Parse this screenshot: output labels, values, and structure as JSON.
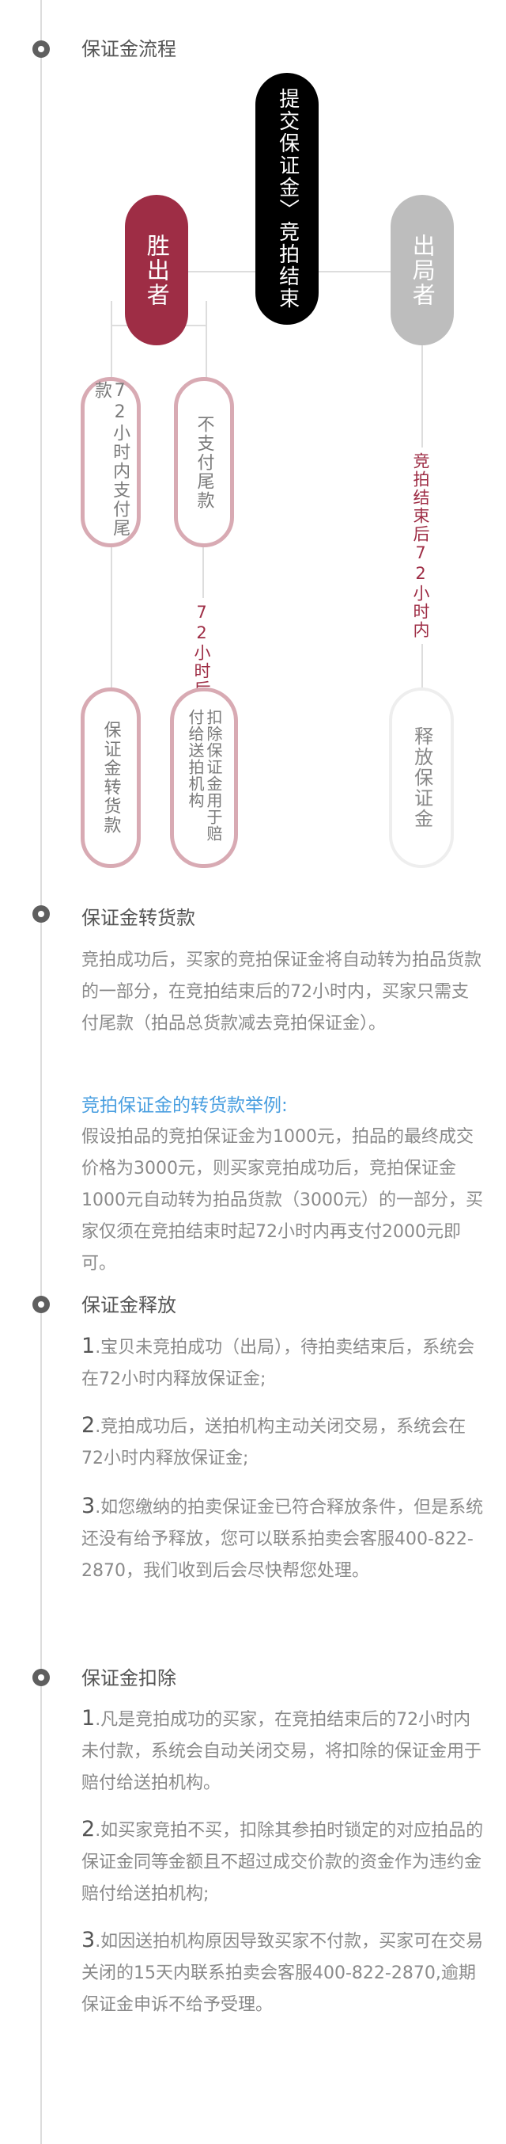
{
  "sections": {
    "flow": {
      "title": "保证金流程",
      "center_pill": "提交保证金〉竞拍结束",
      "winner_pill": "胜出者",
      "loser_pill": "出局者",
      "pay_within": "72小时内支付尾款",
      "not_pay": "不支付尾款",
      "after_72h": "72小时后",
      "to_payment": "保证金转货款",
      "deduct": "扣除保证金用于赔付给送拍机构",
      "loser_note": "竞拍结束后72小时内",
      "release": "释放保证金"
    },
    "convert": {
      "title": "保证金转货款",
      "desc": "竞拍成功后，买家的竞拍保证金将自动转为拍品货款的一部分，在竞拍结束后的72小时内，买家只需支付尾款（拍品总货款减去竞拍保证金）。",
      "example_title": "竞拍保证金的转货款举例:",
      "example": "假设拍品的竞拍保证金为1000元，拍品的最终成交价格为3000元，则买家竞拍成功后，竞拍保证金1000元自动转为拍品货款（3000元）的一部分，买家仅须在竞拍结束时起72小时内再支付2000元即可。"
    },
    "release": {
      "title": "保证金释放",
      "items": [
        {
          "num": "1",
          "text": ".宝贝未竞拍成功（出局），待拍卖结束后，系统会在72小时内释放保证金;"
        },
        {
          "num": "2",
          "text": ".竞拍成功后，送拍机构主动关闭交易，系统会在72小时内释放保证金;"
        },
        {
          "num": "3",
          "text": ".如您缴纳的拍卖保证金已符合释放条件，但是系统还没有给予释放，您可以联系拍卖会客服400-822-2870，我们收到后会尽快帮您处理。"
        }
      ]
    },
    "deduct": {
      "title": "保证金扣除",
      "items": [
        {
          "num": "1",
          "text": ".凡是竞拍成功的买家，在竞拍结束后的72小时内未付款，系统会自动关闭交易，将扣除的保证金用于赔付给送拍机构。"
        },
        {
          "num": "2",
          "text": ".如买家竞拍不买，扣除其参拍时锁定的对应拍品的保证金同等金额且不超过成交价款的资金作为违约金赔付给送拍机构;"
        },
        {
          "num": "3",
          "text": ".如因送拍机构原因导致买家不付款，买家可在交易关闭的15天内联系拍卖会客服400-822-2870,逾期保证金申诉不给予受理。"
        }
      ]
    }
  },
  "colors": {
    "winner": "#9e2d45",
    "center": "#000000",
    "loser": "#bdbdbd",
    "pink_border": "#d8aab3",
    "link_blue": "#4a9fe0"
  }
}
